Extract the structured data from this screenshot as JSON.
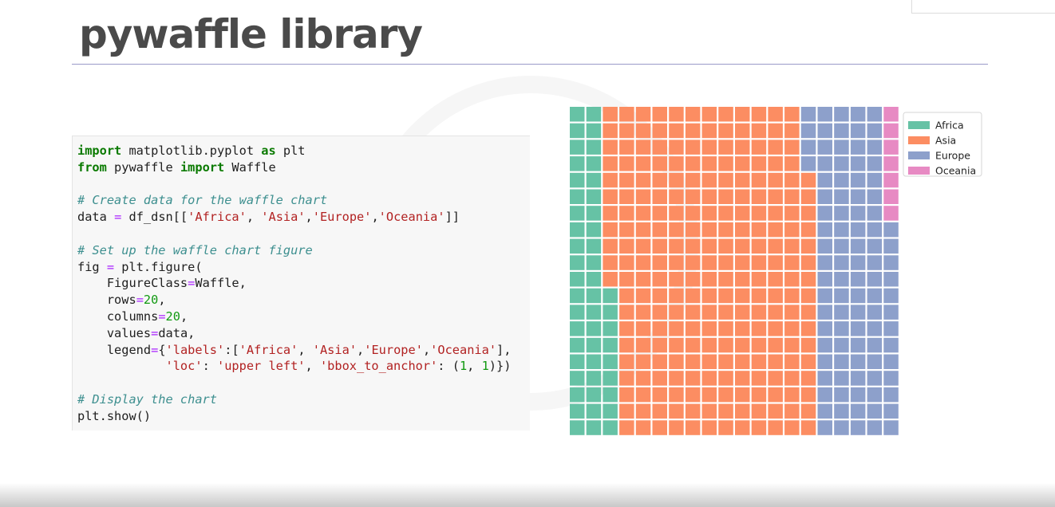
{
  "slide": {
    "title": "pywaffle library"
  },
  "code": {
    "lines": [
      [
        {
          "t": "import",
          "c": "kw"
        },
        {
          "t": " matplotlib.pyplot "
        },
        {
          "t": "as",
          "c": "kw"
        },
        {
          "t": " plt"
        }
      ],
      [
        {
          "t": "from",
          "c": "kw"
        },
        {
          "t": " pywaffle "
        },
        {
          "t": "import",
          "c": "kw"
        },
        {
          "t": " Waffle"
        }
      ],
      [],
      [
        {
          "t": "# Create data for the waffle chart",
          "c": "cm"
        }
      ],
      [
        {
          "t": "data "
        },
        {
          "t": "=",
          "c": "op"
        },
        {
          "t": " df_dsn[["
        },
        {
          "t": "'Africa'",
          "c": "st"
        },
        {
          "t": ", "
        },
        {
          "t": "'Asia'",
          "c": "st"
        },
        {
          "t": ","
        },
        {
          "t": "'Europe'",
          "c": "st"
        },
        {
          "t": ","
        },
        {
          "t": "'Oceania'",
          "c": "st"
        },
        {
          "t": "]]"
        }
      ],
      [],
      [
        {
          "t": "# Set up the waffle chart figure",
          "c": "cm"
        }
      ],
      [
        {
          "t": "fig "
        },
        {
          "t": "=",
          "c": "op"
        },
        {
          "t": " plt.figure("
        }
      ],
      [
        {
          "t": "    FigureClass"
        },
        {
          "t": "=",
          "c": "op"
        },
        {
          "t": "Waffle,"
        }
      ],
      [
        {
          "t": "    rows"
        },
        {
          "t": "=",
          "c": "op"
        },
        {
          "t": "20",
          "c": "nm"
        },
        {
          "t": ","
        }
      ],
      [
        {
          "t": "    columns"
        },
        {
          "t": "=",
          "c": "op"
        },
        {
          "t": "20",
          "c": "nm"
        },
        {
          "t": ","
        }
      ],
      [
        {
          "t": "    values"
        },
        {
          "t": "=",
          "c": "op"
        },
        {
          "t": "data,"
        }
      ],
      [
        {
          "t": "    legend"
        },
        {
          "t": "=",
          "c": "op"
        },
        {
          "t": "{"
        },
        {
          "t": "'labels'",
          "c": "st"
        },
        {
          "t": ":["
        },
        {
          "t": "'Africa'",
          "c": "st"
        },
        {
          "t": ", "
        },
        {
          "t": "'Asia'",
          "c": "st"
        },
        {
          "t": ","
        },
        {
          "t": "'Europe'",
          "c": "st"
        },
        {
          "t": ","
        },
        {
          "t": "'Oceania'",
          "c": "st"
        },
        {
          "t": "],"
        }
      ],
      [
        {
          "t": "            "
        },
        {
          "t": "'loc'",
          "c": "st"
        },
        {
          "t": ": "
        },
        {
          "t": "'upper left'",
          "c": "st"
        },
        {
          "t": ", "
        },
        {
          "t": "'bbox_to_anchor'",
          "c": "st"
        },
        {
          "t": ": ("
        },
        {
          "t": "1",
          "c": "nm"
        },
        {
          "t": ", "
        },
        {
          "t": "1",
          "c": "nm"
        },
        {
          "t": ")})"
        }
      ],
      [],
      [
        {
          "t": "# Display the chart",
          "c": "cm"
        }
      ],
      [
        {
          "t": "plt.show()"
        }
      ]
    ]
  },
  "chart_data": {
    "type": "waffle",
    "rows": 20,
    "columns": 20,
    "fill_order": "column-wise from bottom-left",
    "categories": [
      "Africa",
      "Asia",
      "Europe",
      "Oceania"
    ],
    "values": [
      49,
      247,
      97,
      7
    ],
    "colors": [
      "#66c2a5",
      "#fc8d62",
      "#8da0cb",
      "#e78ac3"
    ],
    "legend": {
      "labels": [
        "Africa",
        "Asia",
        "Europe",
        "Oceania"
      ],
      "loc": "upper left"
    }
  }
}
